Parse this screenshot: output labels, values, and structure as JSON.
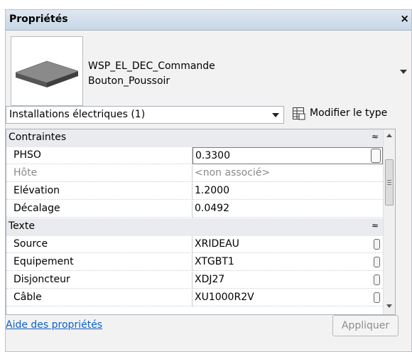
{
  "palette": {
    "title_bg": "#c8d6e6",
    "link": "#1060c8",
    "disabled_text": "#8d8d8d"
  },
  "panel": {
    "title": "Propriétés",
    "close_glyph": "×"
  },
  "type_selector": {
    "line1": "WSP_EL_DEC_Commande",
    "line2": "Bouton_Poussoir",
    "thumbnail_icon": "slab-icon"
  },
  "filter": {
    "selected": "Installations électriques (1)"
  },
  "edit_type": {
    "label": "Modifier le type",
    "icon": "edit-type-icon"
  },
  "groups": [
    {
      "name": "Contraintes",
      "collapse_glyph": "≈",
      "properties": [
        {
          "name": "PHSO",
          "value": "0.3300"
        },
        {
          "name": "Hôte",
          "value": "<non associé>"
        },
        {
          "name": "Elévation",
          "value": "1.2000"
        },
        {
          "name": "Décalage",
          "value": "0.0492"
        }
      ]
    },
    {
      "name": "Texte",
      "collapse_glyph": "≈",
      "properties": [
        {
          "name": "Source",
          "value": "XRIDEAU"
        },
        {
          "name": "Equipement",
          "value": "XTGBT1"
        },
        {
          "name": "Disjoncteur",
          "value": "XDJ27"
        },
        {
          "name": "Câble",
          "value": "XU1000R2V"
        }
      ]
    }
  ],
  "footer": {
    "help_link": "Aide des propriétés",
    "apply_button": "Appliquer"
  }
}
